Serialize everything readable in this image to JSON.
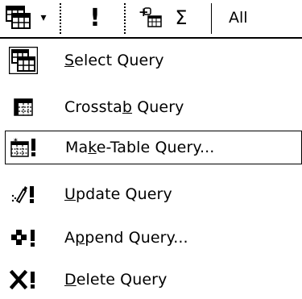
{
  "toolbar": {
    "query_type_icon": "query-type-icon",
    "dropdown_glyph": "▾",
    "run_glyph": "!",
    "show_table_icon": "show-table-icon",
    "totals_glyph": "Σ",
    "top_values": "All"
  },
  "menu": {
    "items": [
      {
        "pre": "",
        "key": "S",
        "post": "elect Query",
        "icon": "select-query-icon",
        "highlighted": false
      },
      {
        "pre": "Crossta",
        "key": "b",
        "post": " Query",
        "icon": "crosstab-query-icon",
        "highlighted": false
      },
      {
        "pre": "Ma",
        "key": "k",
        "post": "e-Table Query...",
        "icon": "make-table-query-icon",
        "highlighted": true
      },
      {
        "pre": "",
        "key": "U",
        "post": "pdate Query",
        "icon": "update-query-icon",
        "highlighted": false
      },
      {
        "pre": "A",
        "key": "p",
        "post": "pend Query...",
        "icon": "append-query-icon",
        "highlighted": false
      },
      {
        "pre": "",
        "key": "D",
        "post": "elete Query",
        "icon": "delete-query-icon",
        "highlighted": false
      }
    ]
  }
}
